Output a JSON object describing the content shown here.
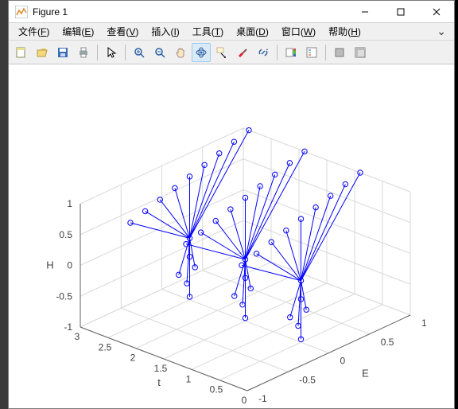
{
  "window": {
    "title": "Figure 1"
  },
  "menubar": {
    "items": [
      {
        "label": "文件",
        "mn": "F"
      },
      {
        "label": "编辑",
        "mn": "E"
      },
      {
        "label": "查看",
        "mn": "V"
      },
      {
        "label": "插入",
        "mn": "I"
      },
      {
        "label": "工具",
        "mn": "T"
      },
      {
        "label": "桌面",
        "mn": "D"
      },
      {
        "label": "窗口",
        "mn": "W"
      },
      {
        "label": "帮助",
        "mn": "H"
      }
    ],
    "overflow_glyph": "⌄"
  },
  "toolbar": {
    "groups": [
      [
        "new-figure",
        "open",
        "save",
        "print"
      ],
      [
        "pointer"
      ],
      [
        "zoom-in",
        "zoom-out",
        "pan",
        "rotate3d",
        "data-cursor",
        "brush",
        "link-data"
      ],
      [
        "insert-colorbar",
        "insert-legend"
      ],
      [
        "hide-plot-tools",
        "show-plot-tools"
      ]
    ],
    "active": "rotate3d"
  },
  "chart_data": {
    "type": "stem3",
    "title": "",
    "axes": {
      "x": {
        "label": "t",
        "lim": [
          0,
          3
        ],
        "ticks": [
          0,
          0.5,
          1,
          1.5,
          2,
          2.5,
          3
        ]
      },
      "y": {
        "label": "E",
        "lim": [
          -1,
          1
        ],
        "ticks": [
          -1,
          -0.5,
          0,
          0.5,
          1
        ]
      },
      "z": {
        "label": "H",
        "lim": [
          -1,
          1
        ],
        "ticks": [
          -1,
          -0.5,
          0,
          0.5,
          1
        ]
      }
    },
    "t_groups": [
      0.5,
      1.5,
      2.5
    ],
    "fan_per_group": {
      "E_values": [
        -1.0,
        -0.75,
        -0.5,
        -0.25,
        0.0,
        0.25,
        0.5,
        0.75,
        1.0
      ],
      "source": {
        "t_offset": 0.0,
        "E": 0.0,
        "H": 0.0
      },
      "target_H": 1.0,
      "target_t_spread": 0.4
    },
    "tail_per_group": {
      "points": [
        {
          "dt": 0.0,
          "E": 0.0,
          "H": -0.95
        },
        {
          "dt": 0.05,
          "E": 0.0,
          "H": -0.75
        },
        {
          "dt": 0.05,
          "E": 0.1,
          "H": -0.55
        },
        {
          "dt": 0.05,
          "E": -0.1,
          "H": -0.55
        },
        {
          "dt": 0.0,
          "E": 0.0,
          "H": -0.3
        }
      ]
    },
    "series_color": "#0000ff",
    "marker": "circle"
  }
}
